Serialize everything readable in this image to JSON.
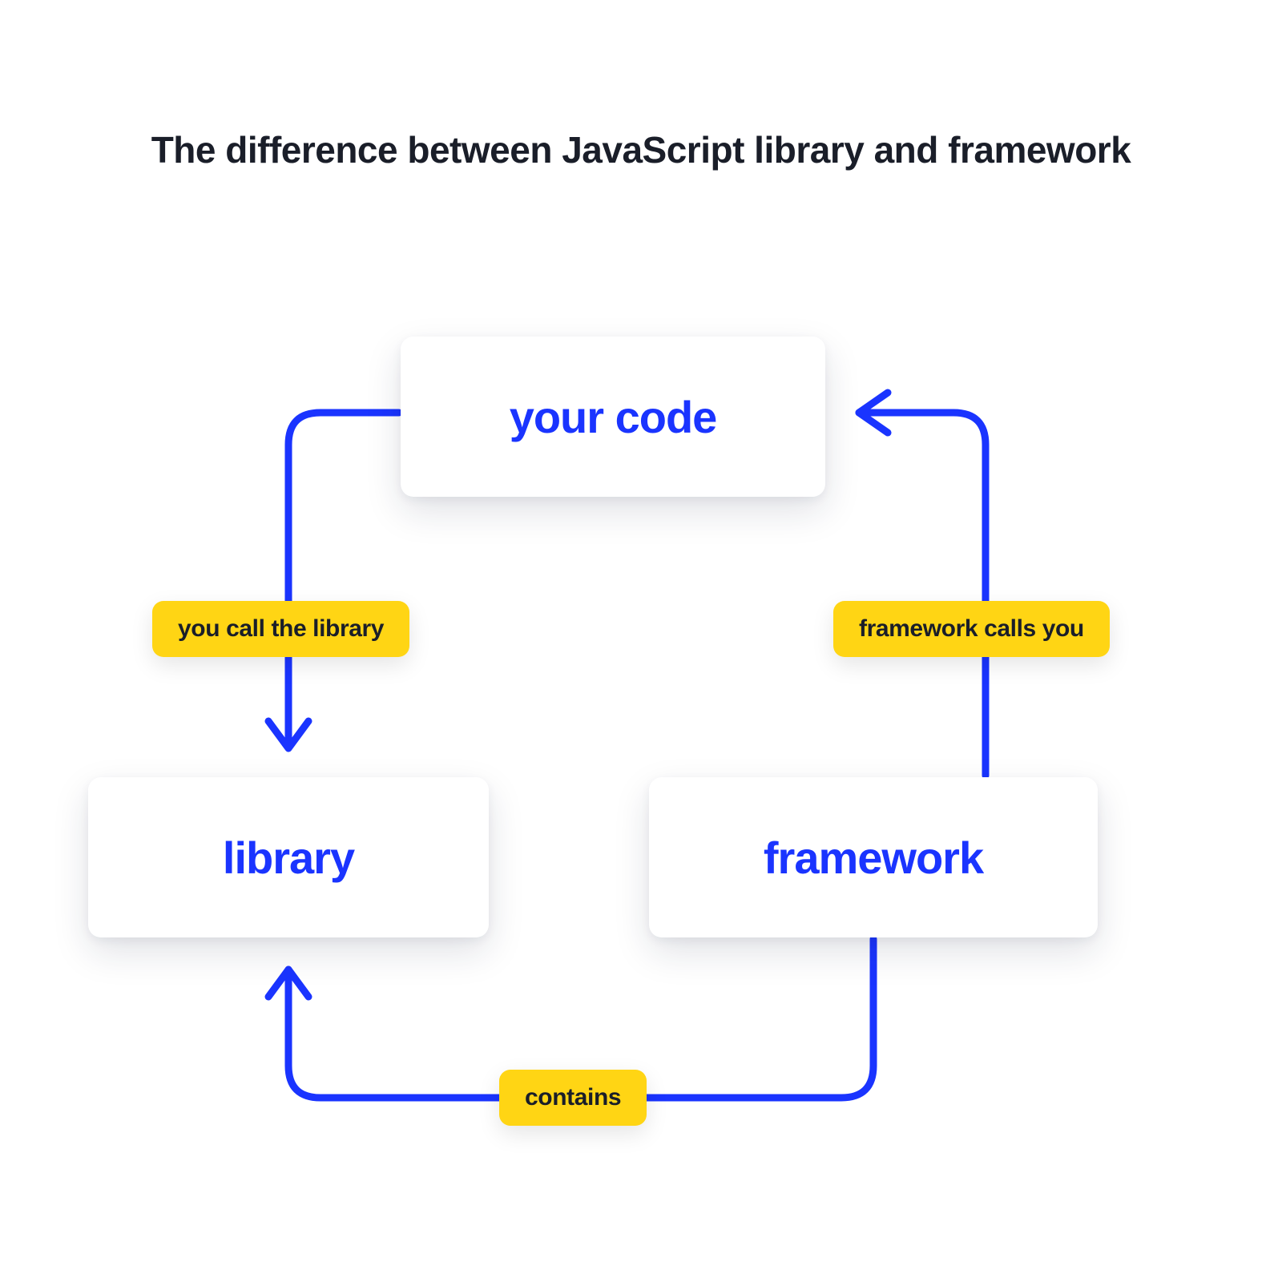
{
  "title": "The difference between JavaScript library and framework",
  "nodes": {
    "your_code": "your code",
    "library": "library",
    "framework": "framework"
  },
  "edges": {
    "you_call_the_library": "you call the library",
    "framework_calls_you": "framework calls you",
    "contains": "contains"
  },
  "colors": {
    "accent_blue": "#1a34ff",
    "pill_yellow": "#ffd514",
    "title_dark": "#1a1e29"
  }
}
